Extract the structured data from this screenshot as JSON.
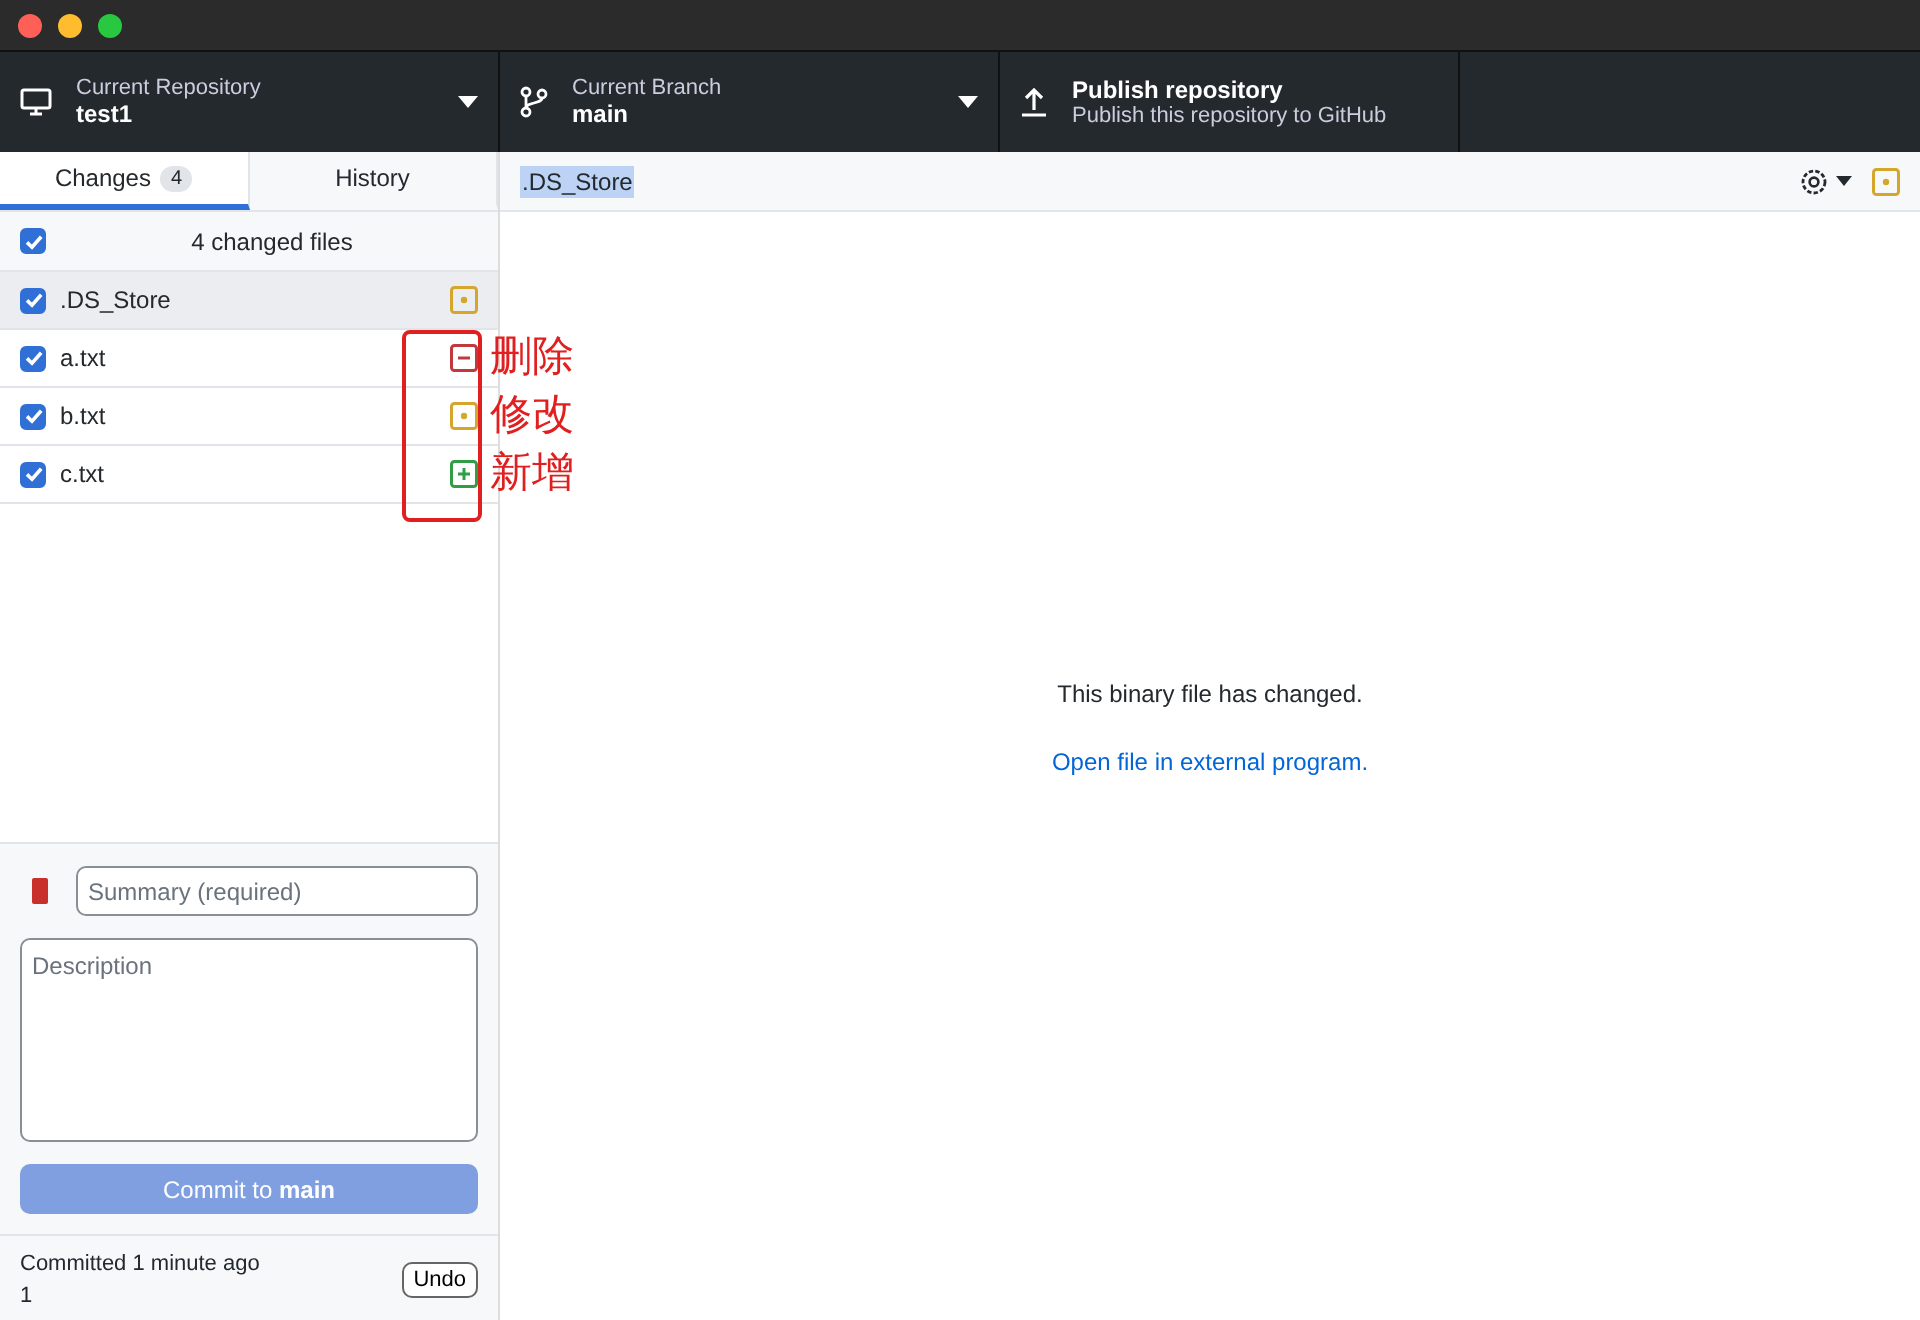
{
  "toolbar": [
    {
      "kind": "repo",
      "label": "Current Repository",
      "value": "test1"
    },
    {
      "kind": "branch",
      "label": "Current Branch",
      "value": "main"
    },
    {
      "kind": "publish",
      "label": "Publish repository",
      "value": "Publish this repository to GitHub"
    }
  ],
  "tabs": [
    {
      "label": "Changes",
      "count": "4",
      "selected": true
    },
    {
      "label": "History",
      "selected": false
    }
  ],
  "changes": {
    "header": "4 changed files",
    "all_checked": true,
    "files": [
      {
        "name": ".DS_Store",
        "kind": "modified",
        "checked": true,
        "selected": true
      },
      {
        "name": "a.txt",
        "kind": "deleted",
        "checked": true,
        "selected": false
      },
      {
        "name": "b.txt",
        "kind": "modified",
        "checked": true,
        "selected": false
      },
      {
        "name": "c.txt",
        "kind": "added",
        "checked": true,
        "selected": false
      }
    ]
  },
  "annotation": {
    "labels": [
      "删除",
      "修改",
      "新增"
    ]
  },
  "commit": {
    "summary_placeholder": "Summary (required)",
    "description_placeholder": "Description",
    "button": "Commit to **main**",
    "disabled": true
  },
  "last_commit": {
    "text": "Committed 1 minute ago",
    "message": "1",
    "undo": "Undo"
  },
  "diff": {
    "file": ".DS_Store",
    "kind": "modified",
    "message": "This binary file has changed.",
    "link": "Open file in external program."
  }
}
